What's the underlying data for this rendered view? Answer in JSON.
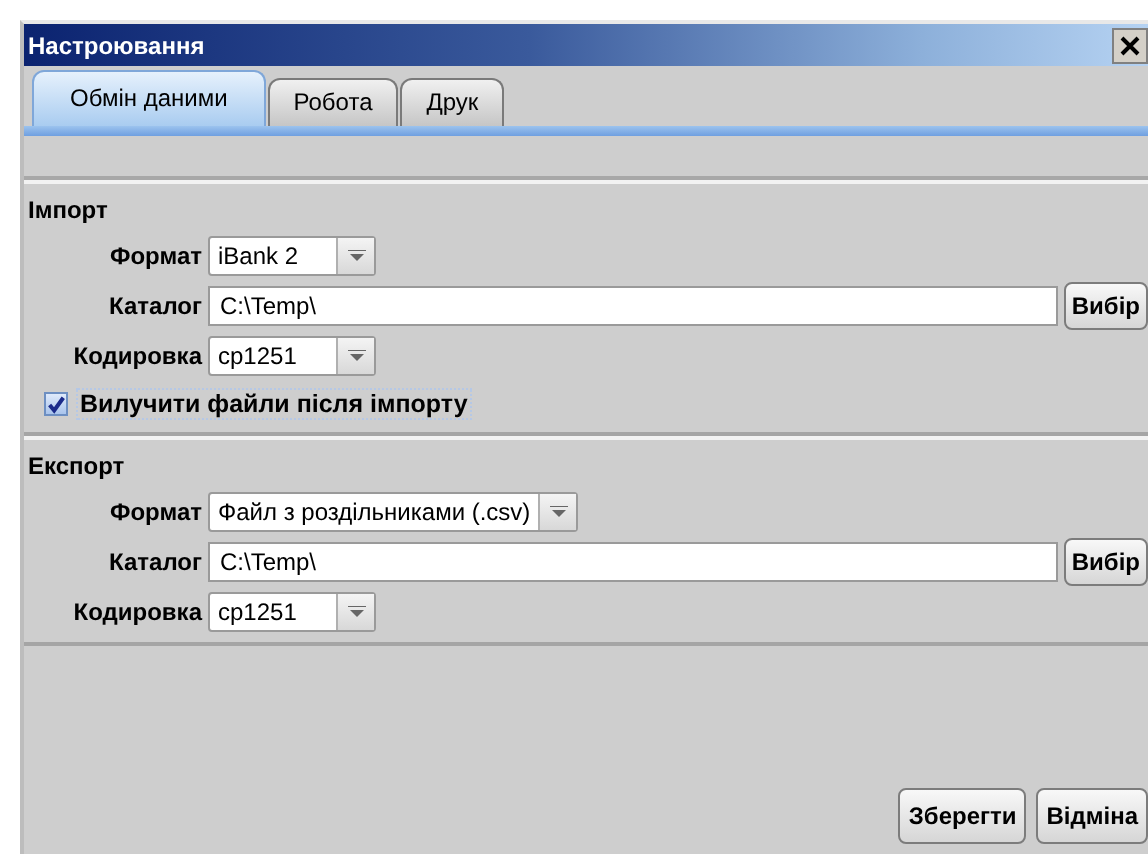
{
  "window": {
    "title": "Настроювання"
  },
  "tabs": [
    {
      "label": "Обмін даними",
      "selected": true
    },
    {
      "label": "Робота",
      "selected": false
    },
    {
      "label": "Друк",
      "selected": false
    }
  ],
  "sections": [
    {
      "title": "Імпорт",
      "fields": [
        {
          "kind": "combo",
          "label": "Формат",
          "value": "iBank 2"
        },
        {
          "kind": "text",
          "label": "Каталог",
          "value": "C:\\Temp\\",
          "button": "Вибір"
        },
        {
          "kind": "combo",
          "label": "Кодировка",
          "value": "cp1251"
        }
      ],
      "checkbox": {
        "label": "Вилучити файли після імпорту",
        "checked": true
      }
    },
    {
      "title": "Експорт",
      "fields": [
        {
          "kind": "combo",
          "label": "Формат",
          "value": "Файл з роздільниками (.csv)"
        },
        {
          "kind": "text",
          "label": "Каталог",
          "value": "C:\\Temp\\",
          "button": "Вибір"
        },
        {
          "kind": "combo",
          "label": "Кодировка",
          "value": "cp1251"
        }
      ]
    }
  ],
  "buttons": [
    "Зберегти",
    "Відміна"
  ]
}
